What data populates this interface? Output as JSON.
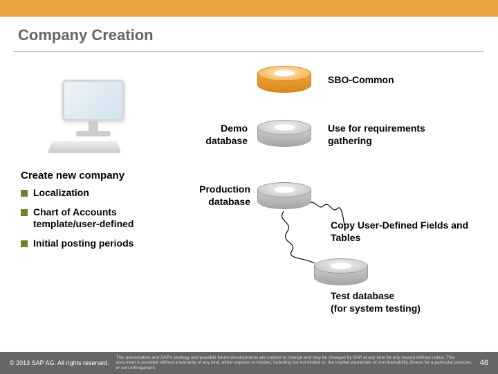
{
  "title": "Company Creation",
  "dbs": {
    "sbo": {
      "label": "SBO-Common"
    },
    "demo": {
      "left_label": "Demo\ndatabase",
      "right_label": "Use for requirements gathering"
    },
    "prod": {
      "left_label": "Production\ndatabase"
    },
    "copy_label": "Copy User-Defined Fields and Tables",
    "test": {
      "label": "Test database\n(for system testing)"
    }
  },
  "section_heading": "Create new company",
  "bullets": [
    "Localization",
    "Chart of Accounts template/user-defined",
    "Initial posting periods"
  ],
  "footer": {
    "copyright": "© 2013 SAP AG. All rights reserved.",
    "legal": "This presentation and SAP's strategy and possible future developments are subject to change and may be changed by SAP at any time for any reason without notice. This document is provided without a warranty of any kind, either express or implied, including but not limited to, the implied warranties of merchantability, fitness for a particular purpose, or non-infringement.",
    "page": "46"
  }
}
